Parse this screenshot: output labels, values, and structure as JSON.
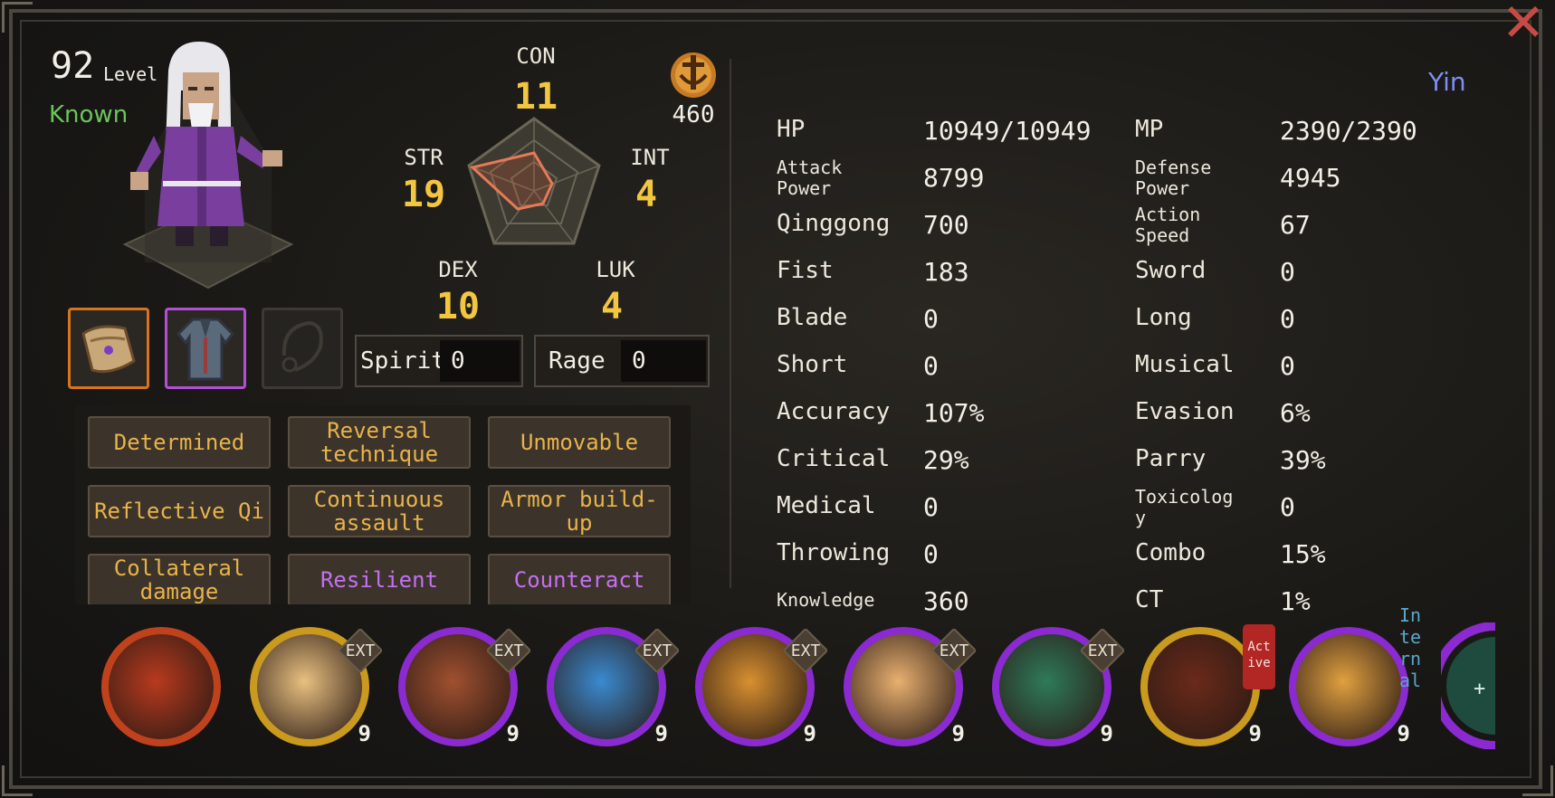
{
  "window": {
    "close_icon": "close-x-icon",
    "accent_close": "#c84a44"
  },
  "character": {
    "level_number": "92",
    "level_label": "Level",
    "status": "Known",
    "status_color": "#6cc55a",
    "portrait_icon": "elder-sage-portrait"
  },
  "equipment": [
    {
      "icon": "scroll-bundle-icon",
      "rarity_color": "#d8741e"
    },
    {
      "icon": "robe-armor-icon",
      "rarity_color": "#b24fd6"
    },
    {
      "icon": "empty-necklace-slot-icon",
      "rarity_color": "#3d3a34"
    }
  ],
  "attributes": {
    "con": {
      "label": "CON",
      "value": "11"
    },
    "str": {
      "label": "STR",
      "value": "19"
    },
    "int": {
      "label": "INT",
      "value": "4"
    },
    "dex": {
      "label": "DEX",
      "value": "10"
    },
    "luk": {
      "label": "LUK",
      "value": "4"
    }
  },
  "currency": {
    "icon": "sect-sword-emblem-icon",
    "value": "460"
  },
  "resources": {
    "spirit": {
      "label": "Spirit",
      "value": "0"
    },
    "rage": {
      "label": "Rage",
      "value": "0"
    }
  },
  "traits": [
    {
      "label": "Determined",
      "color": "#e8b34a"
    },
    {
      "label": "Reversal technique",
      "color": "#e8b34a"
    },
    {
      "label": "Unmovable",
      "color": "#e8b34a"
    },
    {
      "label": "Reflective Qi",
      "color": "#e8b34a"
    },
    {
      "label": "Continuous assault",
      "color": "#e8b34a"
    },
    {
      "label": "Armor build-up",
      "color": "#e8b34a"
    },
    {
      "label": "Collateral damage",
      "color": "#e8b34a"
    },
    {
      "label": "Resilient",
      "color": "#c470f0"
    },
    {
      "label": "Counteract",
      "color": "#c470f0"
    }
  ],
  "alignment": {
    "label": "Yin",
    "color": "#7f8ef0"
  },
  "stats_left": [
    {
      "label": "HP",
      "value": "10949/10949"
    },
    {
      "label": "Attack\nPower",
      "value": "8799"
    },
    {
      "label": "Qinggong",
      "value": "700"
    },
    {
      "label": "Fist",
      "value": "183"
    },
    {
      "label": "Blade",
      "value": "0"
    },
    {
      "label": "Short",
      "value": "0"
    },
    {
      "label": "Accuracy",
      "value": "107%"
    },
    {
      "label": "Critical",
      "value": "29%"
    },
    {
      "label": "Medical",
      "value": "0"
    },
    {
      "label": "Throwing",
      "value": "0"
    },
    {
      "label": "Knowledge",
      "value": "360"
    }
  ],
  "stats_right": [
    {
      "label": "MP",
      "value": "2390/2390"
    },
    {
      "label": "Defense\nPower",
      "value": "4945"
    },
    {
      "label": "Action\nSpeed",
      "value": "67"
    },
    {
      "label": "Sword",
      "value": "0"
    },
    {
      "label": "Long",
      "value": "0"
    },
    {
      "label": "Musical",
      "value": "0"
    },
    {
      "label": "Evasion",
      "value": "6%"
    },
    {
      "label": "Parry",
      "value": "39%"
    },
    {
      "label": "Toxicolog\ny",
      "value": "0"
    },
    {
      "label": "Combo",
      "value": "15%"
    },
    {
      "label": "CT",
      "value": "1%"
    }
  ],
  "skills": [
    {
      "icon": "phoenix-seal-skill-icon",
      "ring_color": "#c0421c",
      "level": "",
      "badge": ""
    },
    {
      "icon": "flame-palm-skill-icon",
      "ring_color": "#c99a1e",
      "level": "9",
      "badge": "EXT"
    },
    {
      "icon": "clasped-hands-skill-icon",
      "ring_color": "#8a2ad0",
      "level": "9",
      "badge": "EXT"
    },
    {
      "icon": "ice-palm-skill-icon",
      "ring_color": "#8a2ad0",
      "level": "9",
      "badge": "EXT"
    },
    {
      "icon": "golden-palm-skill-icon",
      "ring_color": "#8a2ad0",
      "level": "9",
      "badge": "EXT"
    },
    {
      "icon": "radiant-strike-skill-icon",
      "ring_color": "#8a2ad0",
      "level": "9",
      "badge": "EXT"
    },
    {
      "icon": "jade-palm-skill-icon",
      "ring_color": "#8a2ad0",
      "level": "9",
      "badge": "EXT"
    },
    {
      "icon": "meditation-skill-icon",
      "ring_color": "#c99a1e",
      "level": "9",
      "badge": "Act\nive"
    },
    {
      "icon": "inner-energy-skill-icon",
      "ring_color": "#8a2ad0",
      "level": "9",
      "badge": "In\nte\nrn\nal"
    }
  ]
}
